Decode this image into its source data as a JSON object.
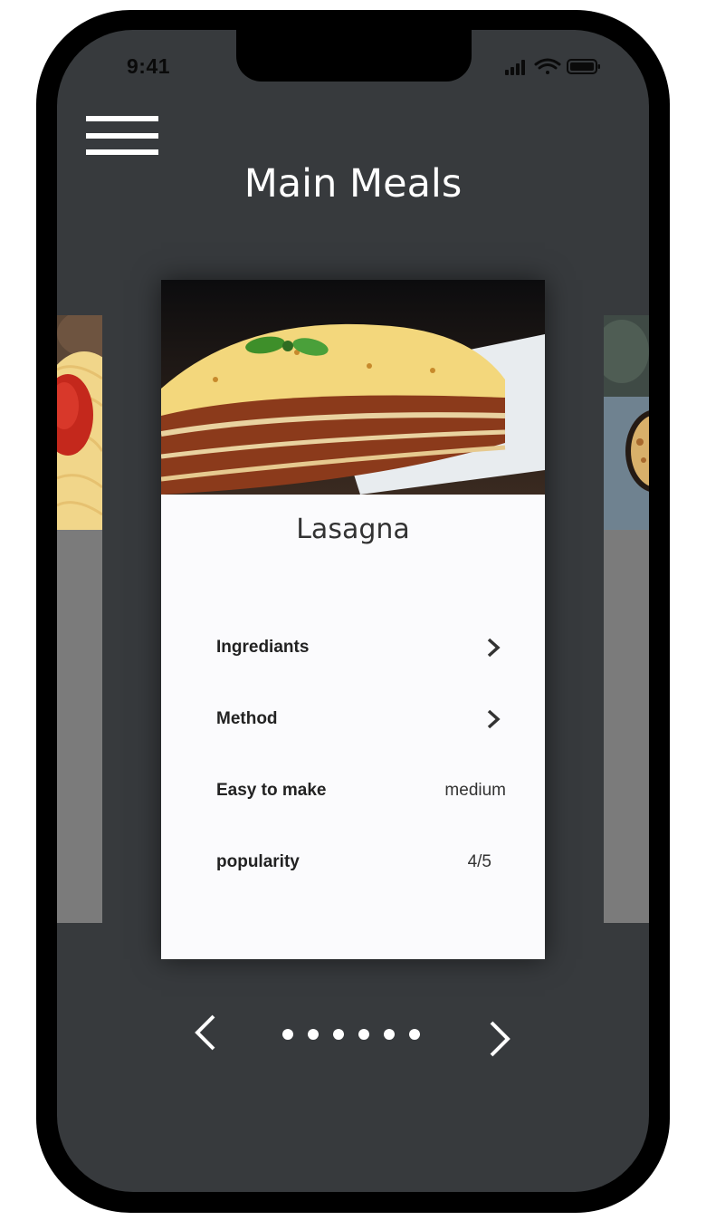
{
  "status_bar": {
    "time": "9:41"
  },
  "header": {
    "title": "Main Meals"
  },
  "card": {
    "name": "Lasagna",
    "rows": [
      {
        "label": "Ingrediants"
      },
      {
        "label": "Method"
      },
      {
        "label": "Easy to make",
        "value": "medium"
      },
      {
        "label": "popularity",
        "value": "4/5"
      }
    ]
  },
  "pager": {
    "dot_count": 6
  },
  "icons": {
    "menu": "hamburger-icon",
    "prev": "chevron-left-icon",
    "next": "chevron-right-icon",
    "row_arrow": "chevron-right-icon"
  },
  "colors": {
    "background": "#373a3d",
    "card": "#fbfbfd",
    "side_card": "#7b7b7b",
    "text_on_dark": "#ffffff"
  }
}
